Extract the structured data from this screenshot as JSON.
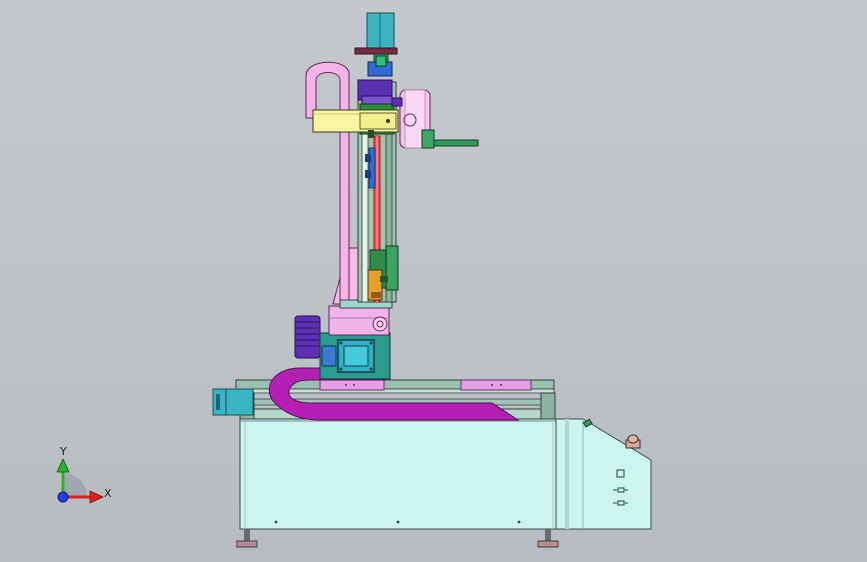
{
  "scene": {
    "view": "front",
    "background": "#c1c5ca",
    "colors": {
      "cabinet": "#ccf6f0",
      "cabinet_dark": "#a9e3dc",
      "pink": "#f4b8e8",
      "magenta": "#b51fb1",
      "yellow_arm": "#f9f7a6",
      "green": "#2f9a5c",
      "dark_green": "#23603c",
      "cyan_motor": "#3fb8c4",
      "blue": "#2f4bd1",
      "purple": "#5d2fb6",
      "red_rail": "#ff4a4a",
      "rail_frame": "#7c9b8a",
      "tan_slide": "#d6a06a"
    }
  },
  "triad": {
    "x_label": "X",
    "y_label": "Y",
    "x_color": "#e02020",
    "y_color": "#26b326",
    "z_color": "#2040e0"
  }
}
